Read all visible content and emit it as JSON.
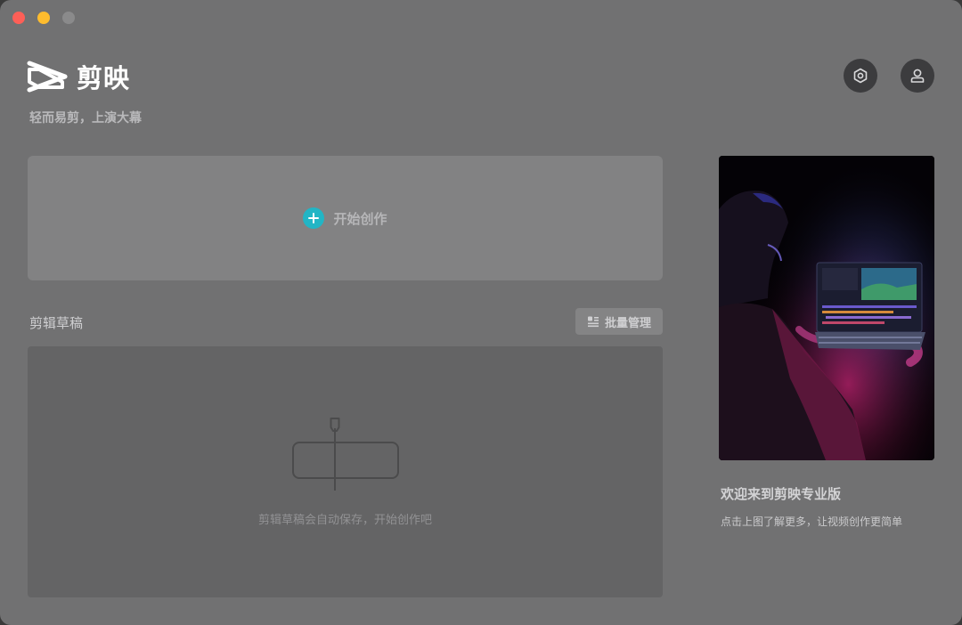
{
  "app": {
    "name": "剪映",
    "slogan": "轻而易剪，上演大幕"
  },
  "window_controls": [
    "close",
    "minimize",
    "zoom"
  ],
  "header": {
    "settings_icon": "hexagon-settings-icon",
    "account_icon": "user-icon"
  },
  "start": {
    "label": "开始创作",
    "icon": "plus-icon",
    "accent_color": "#22b5c5"
  },
  "drafts": {
    "title": "剪辑草稿",
    "batch_label": "批量管理",
    "batch_icon": "list-manage-icon",
    "empty_text": "剪辑草稿会自动保存，开始创作吧"
  },
  "promo": {
    "title": "欢迎来到剪映专业版",
    "subtitle": "点击上图了解更多，让视频创作更简单"
  }
}
